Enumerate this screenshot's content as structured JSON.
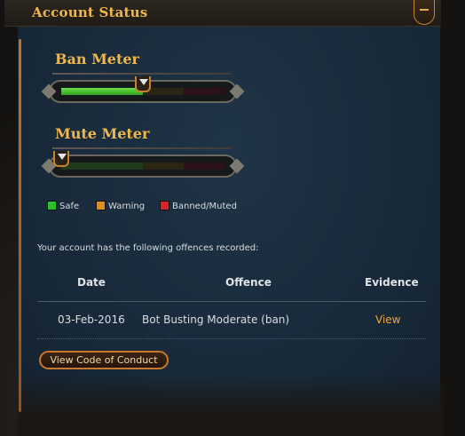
{
  "header": {
    "title": "Account Status"
  },
  "ban_meter": {
    "title": "Ban Meter",
    "level": 0.5
  },
  "mute_meter": {
    "title": "Mute Meter",
    "level": 0.0
  },
  "legend": [
    {
      "label": "Safe",
      "color": "#2fbf2a"
    },
    {
      "label": "Warning",
      "color": "#e0901a"
    },
    {
      "label": "Banned/Muted",
      "color": "#d8232a"
    }
  ],
  "offences": {
    "intro": "Your account has the following offences recorded:",
    "columns": [
      "Date",
      "Offence",
      "Evidence"
    ],
    "rows": [
      {
        "date": "03-Feb-2016",
        "offence": "Bot Busting Moderate (ban)",
        "evidence": "View"
      }
    ]
  },
  "buttons": {
    "code_of_conduct": "View Code of Conduct"
  }
}
